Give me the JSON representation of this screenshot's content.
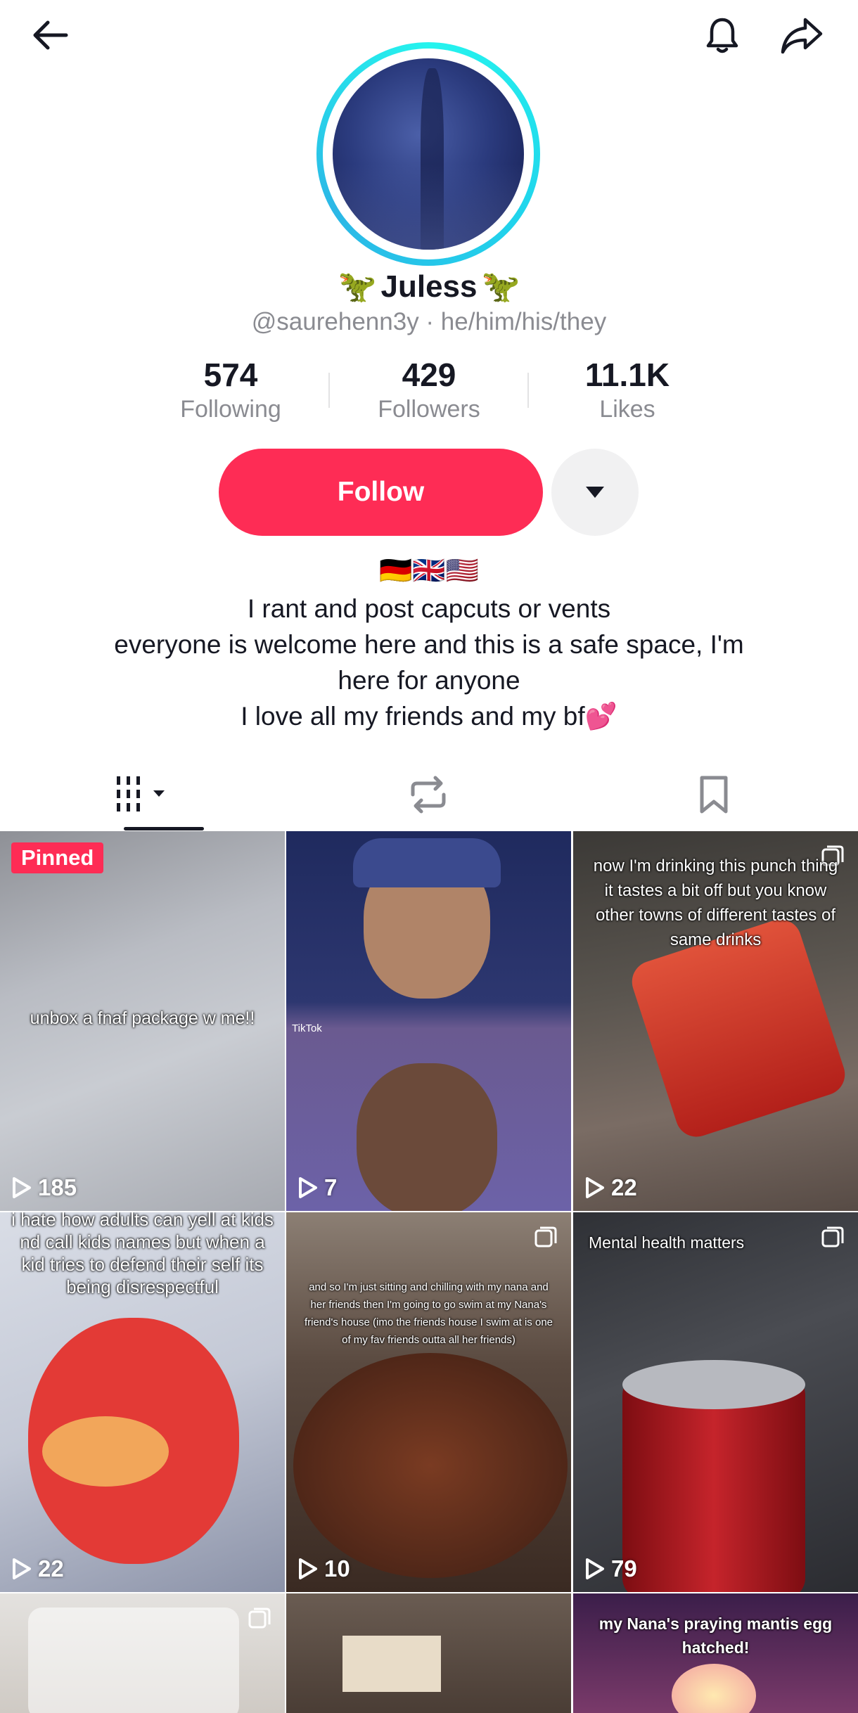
{
  "profile": {
    "name": "Juless",
    "name_emoji": "🦖",
    "handle_line": "@saurehenn3y · he/him/his/they",
    "flags": "🇩🇪🇬🇧🇺🇸",
    "bio_lines": [
      "I rant and post capcuts or vents",
      "everyone is welcome here and this is a safe space, I'm",
      "here for anyone",
      "I love all my friends and my bf💕"
    ]
  },
  "stats": {
    "following": {
      "value": "574",
      "label": "Following"
    },
    "followers": {
      "value": "429",
      "label": "Followers"
    },
    "likes": {
      "value": "11.1K",
      "label": "Likes"
    }
  },
  "actions": {
    "follow_label": "Follow"
  },
  "icons": {
    "back": "back-arrow-icon",
    "bell": "bell-icon",
    "share": "share-arrow-icon",
    "dropdown": "caret-down-icon",
    "videos_tab": "grid-videos-icon",
    "reposts_tab": "repost-icon",
    "favorites_tab": "bookmark-icon",
    "play": "play-icon",
    "multi": "carousel-icon"
  },
  "colors": {
    "accent": "#fe2c55",
    "avatar_ring": "#25f4ee",
    "muted_text": "#8a8b91"
  },
  "videos": [
    {
      "views": "185",
      "pinned_label": "Pinned",
      "caption": "unbox a fnaf package w me!!"
    },
    {
      "views": "7",
      "caption": "",
      "watermark": "TikTok"
    },
    {
      "views": "22",
      "caption": "now I'm drinking this punch thing it tastes a bit off but you know other towns of different tastes of same drinks"
    },
    {
      "views": "22",
      "caption": "i hate how adults can yell at kids nd call kids names but when a kid tries to defend their self its being disrespectful"
    },
    {
      "views": "10",
      "caption": "and so I'm just sitting and chilling with my nana and her friends then I'm going to go swim at my Nana's friend's house (imo the friends house I swim at is one of my fav friends outta all her friends)"
    },
    {
      "views": "79",
      "caption": "Mental health matters"
    },
    {
      "views": "",
      "caption": ""
    },
    {
      "views": "",
      "caption": ""
    },
    {
      "views": "",
      "caption": "my Nana's praying mantis egg hatched!"
    }
  ]
}
